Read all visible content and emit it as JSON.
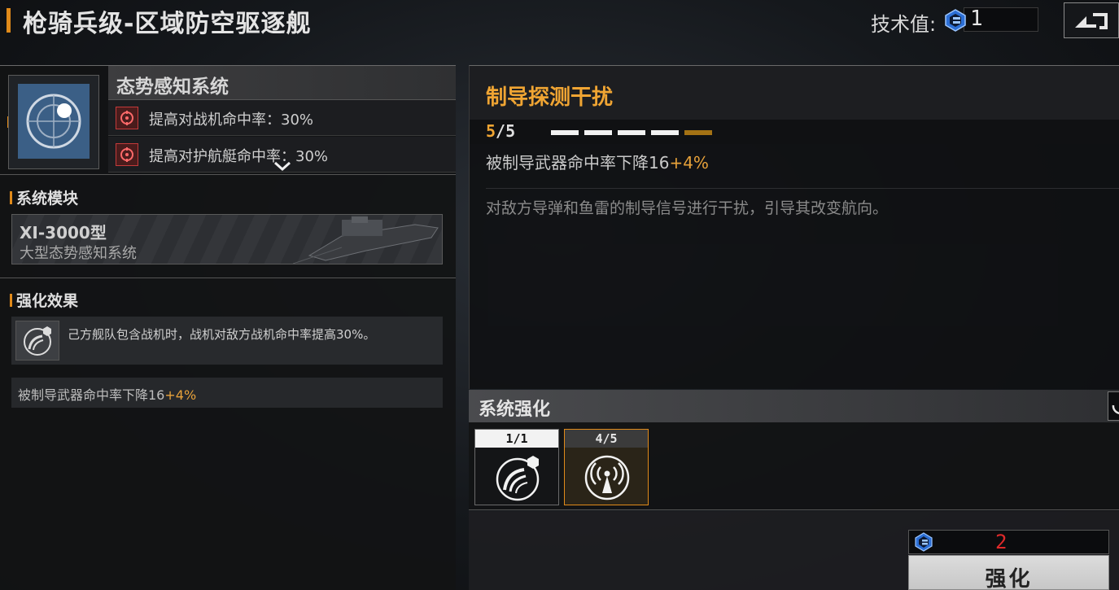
{
  "header": {
    "title": "枪骑兵级-区域防空驱逐舰",
    "tech_label": "技术值:",
    "tech_value": "1"
  },
  "system": {
    "name": "态势感知系统",
    "bonuses": [
      {
        "text": "提高对战机命中率：30%"
      },
      {
        "text": "提高对护航艇命中率：30%"
      }
    ]
  },
  "module_section": {
    "heading": "系统模块",
    "name": "XI-3000型",
    "subtitle": "大型态势感知系统"
  },
  "effect_section": {
    "heading": "强化效果",
    "effect_text": "己方舰队包含战机时，战机对敌方战机命中率提高30%。",
    "stat_base": "被制导武器命中率下降16",
    "stat_bonus": "+4%"
  },
  "detail": {
    "title": "制导探测干扰",
    "level_current": "5",
    "level_total": "/5",
    "stat_base": "被制导武器命中率下降16",
    "stat_bonus": "+4%",
    "description": "对敌方导弹和鱼雷的制导信号进行干扰，引导其改变航向。"
  },
  "upgrades": {
    "heading": "系统强化",
    "items": [
      {
        "count": "1/1",
        "icon": "radar-dish-icon"
      },
      {
        "count": "4/5",
        "icon": "signal-tower-icon"
      }
    ]
  },
  "action": {
    "cost": "2",
    "button_label": "强化"
  },
  "colors": {
    "accent_orange": "#f0a533",
    "cost_red": "#e02a2a",
    "module_blue": "#3b5f86"
  }
}
